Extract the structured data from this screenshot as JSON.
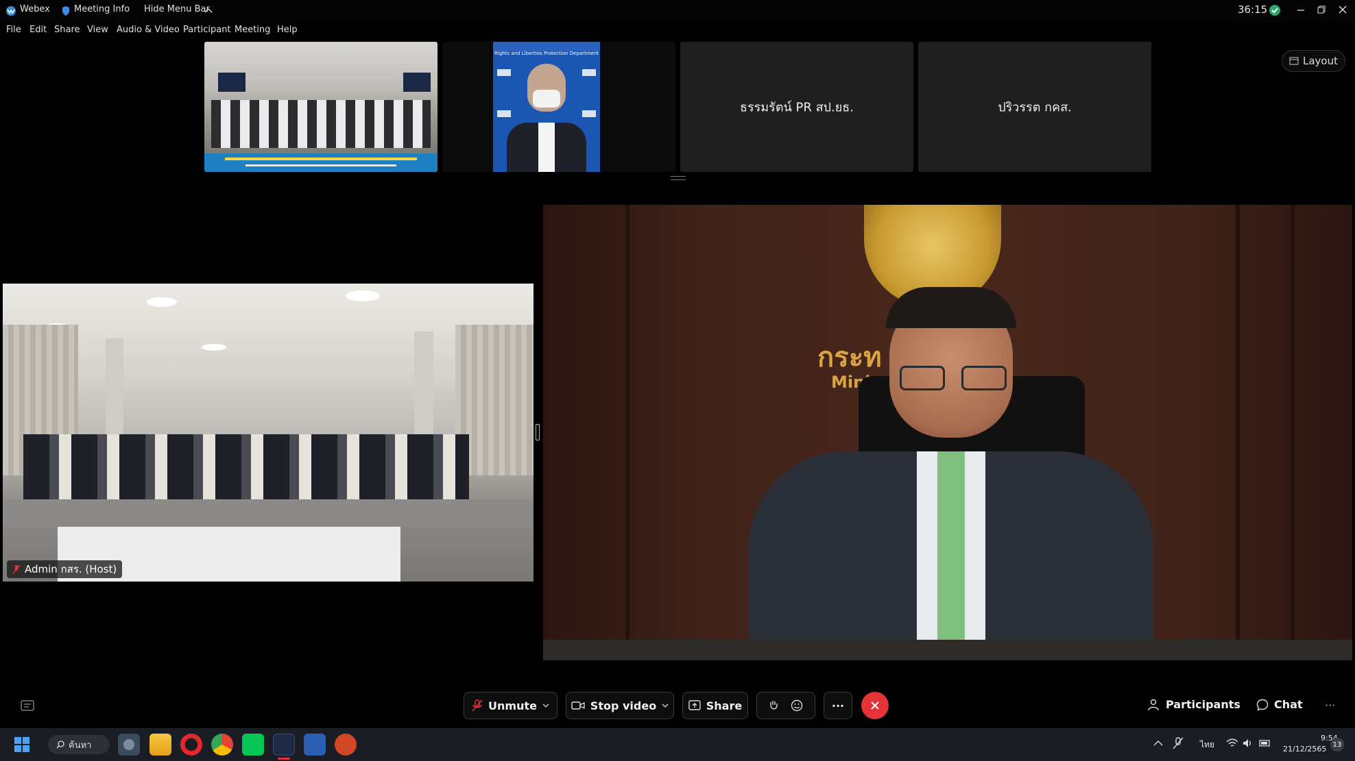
{
  "titlebar": {
    "app_name": "Webex",
    "meeting_info": "Meeting Info",
    "hide_menu": "Hide Menu Bar",
    "timer": "36:15"
  },
  "menu": [
    "File",
    "Edit",
    "Share",
    "View",
    "Audio & Video",
    "Participant",
    "Meeting",
    "Help"
  ],
  "layout_button": "Layout",
  "tiles": [
    {
      "name": "ธรรมรัตน์ PR สป.ยธ."
    },
    {
      "name": "ปริวรรต กคส."
    }
  ],
  "thumb_banner": {
    "top_text": "Rights and Liberties Protection Department"
  },
  "main_video": {
    "wall_text_thai": "กระท         รม",
    "wall_text_en": "Mini"
  },
  "host_label": "Admin กสร. (Host)",
  "toolbar": {
    "unmute": "Unmute",
    "stop_video": "Stop video",
    "share": "Share",
    "more": "···",
    "participants": "Participants",
    "chat": "Chat",
    "overflow": "···"
  },
  "taskbar": {
    "search": "ค้นหา",
    "lang": "ไทย",
    "time": "9:54",
    "date": "21/12/2565",
    "notif_count": "13"
  },
  "colors": {
    "leave_red": "#e5333a",
    "tile_bg": "#1f1f1f",
    "wall_brown": "#3b2018"
  }
}
